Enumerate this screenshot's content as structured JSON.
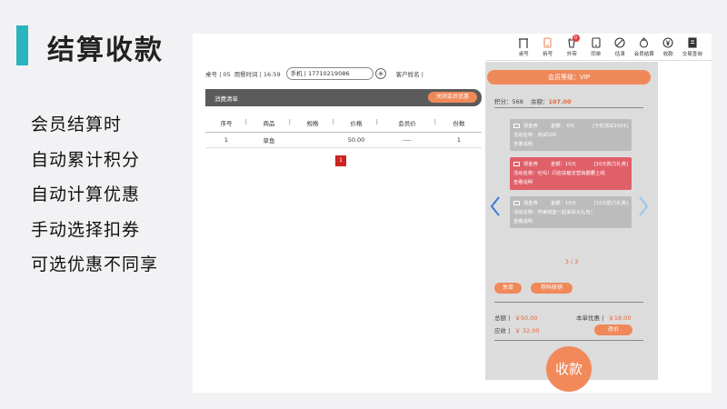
{
  "slide": {
    "title": "结算收款",
    "features": [
      "会员结算时",
      "自动累计积分",
      "自动计算优惠",
      "手动选择扣券",
      "可选优惠不同享"
    ]
  },
  "toolbar": {
    "items": [
      {
        "label": "桌号",
        "icon": "table-icon"
      },
      {
        "label": "拆号",
        "icon": "phone-icon"
      },
      {
        "label": "外带",
        "icon": "takeout-icon",
        "badge": "0"
      },
      {
        "label": "同单",
        "icon": "tablet-icon"
      },
      {
        "label": "估清",
        "icon": "ban-icon"
      },
      {
        "label": "会员结算",
        "icon": "bag-icon"
      },
      {
        "label": "收款",
        "icon": "yen-icon"
      },
      {
        "label": "交易查询",
        "icon": "receipt-icon"
      }
    ]
  },
  "order": {
    "table_text": "桌号 | 05",
    "time_text": "用餐时间 | 16:59",
    "phone_value": "手机 | 17710219086",
    "customer_label": "客户姓名 |"
  },
  "list": {
    "title": "消费清单",
    "close_vip_label": "关闭会员优惠",
    "headers": [
      "序号",
      "商品",
      "规格",
      "价格",
      "会员价",
      "份数"
    ],
    "rows": [
      [
        "1",
        "草鱼",
        "",
        "50.00",
        "----",
        "1"
      ]
    ],
    "page": "1"
  },
  "vip": {
    "level": "会员等级：VIP",
    "points_text": "积分：568",
    "balance_label": "余额：",
    "balance_value": "107.00",
    "coupons": [
      {
        "type": "现金券",
        "amount": "金额：  0元",
        "tag": "[卡包测试1024]",
        "activity": "活动名称：测试000",
        "link": "查看说明",
        "style": "grey"
      },
      {
        "type": "现金券",
        "amount": "金额：10元",
        "tag": "[10元购力礼券]",
        "activity": "活动名称：吐吗！闪店扶植定营销霸腰上线",
        "link": "查看说明",
        "style": "red"
      },
      {
        "type": "现金券",
        "amount": "金额：10元",
        "tag": "[10元助力礼券]",
        "activity": "活动名称：呼唤钱盒一起来拆大礼包！",
        "link": "查看说明",
        "style": "grey"
      }
    ],
    "pager": "3 / 3",
    "free_label": "免单",
    "verify_label": "券码核销",
    "total_label": "总额 |",
    "total_value": "￥50.00",
    "discount_label": "本单优惠 |",
    "discount_value": "￥18.00",
    "due_label": "应收 |",
    "due_value": "￥ 32.00",
    "change_price_label": "改价",
    "pay_label": "收款"
  },
  "colors": {
    "accent": "#2bb3c0",
    "orange": "#f0895a",
    "red": "#e0606a",
    "header_dark": "#5c5b5b"
  }
}
